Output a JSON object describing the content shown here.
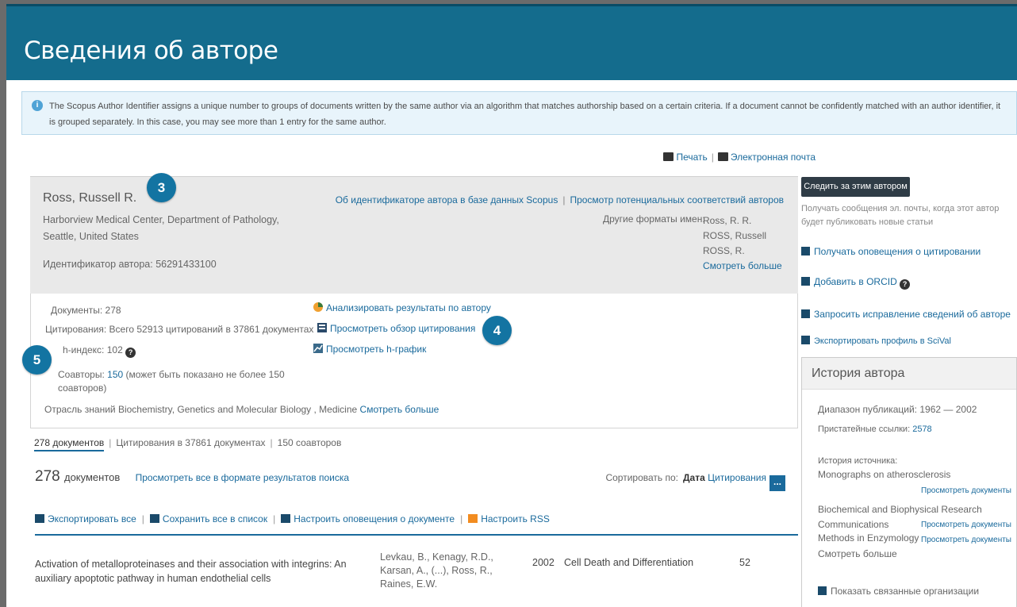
{
  "header": {
    "title": "Сведения об авторе"
  },
  "info": {
    "icon": "info-icon",
    "text": "The Scopus Author Identifier assigns a unique number to groups of documents written by the same author via an algorithm that matches authorship based on a certain criteria. If a document cannot be confidently matched with an author identifier, it is grouped separately. In this case, you may see more than 1 entry for the same author."
  },
  "toolbar": {
    "print": "Печать",
    "email": "Электронная почта"
  },
  "author": {
    "name": "Ross, Russell R.",
    "affiliation": "Harborview Medical Center, Department of Pathology, Seattle, United States",
    "author_id": "Идентификатор автора: 56291433100",
    "link_about_id": "Об идентификаторе автора в базе данных Scopus",
    "link_potential": "Просмотр потенциальных соответствий авторов",
    "other_formats_label": "Другие форматы имен:",
    "other_formats": [
      "Ross, R. R.",
      "ROSS, Russell",
      "ROSS, R."
    ],
    "show_more": "Смотреть больше"
  },
  "badges": {
    "b3": "3",
    "b4": "4",
    "b5": "5"
  },
  "metrics": {
    "documents_label": "Документы:",
    "documents_value": "278",
    "citations_label": "Цитирования:",
    "citations_value": "Всего 52913 цитирований в 37861 документах",
    "hindex_label": "h-индекс:",
    "hindex_value": "102",
    "coauthors_label": "Соавторы:",
    "coauthors_value": "150",
    "coauthors_note": "(может быть показано не более 150 соавторов)",
    "subject_label": "Отрасль знаний",
    "subject_value": "Biochemistry, Genetics and Molecular Biology ,  Medicine",
    "subject_more": "Смотреть больше",
    "link_analyze": "Анализировать результаты по автору",
    "link_citation_overview": "Просмотреть обзор цитирования",
    "link_hgraph": "Просмотреть h-график"
  },
  "tabs": [
    "278 документов",
    "Цитирования в 37861 документах",
    "150 соавторов"
  ],
  "results": {
    "count": "278",
    "count_label": "документов",
    "view_all": "Просмотреть все в формате результатов поиска",
    "sort_label": "Сортировать по:",
    "sort_date": "Дата",
    "sort_citations": "Цитирования",
    "sort_more": "..."
  },
  "actions": [
    "Экспортировать все",
    "Сохранить все в список",
    "Настроить оповещения о документе",
    "Настроить RSS"
  ],
  "documents": [
    {
      "title": "Activation of metalloproteinases and their association with integrins: An auxiliary apoptotic pathway in human endothelial cells",
      "authors": "Levkau, B., Kenagy, R.D., Karsan, A., (...), Ross, R., Raines, E.W.",
      "year": "2002",
      "source": "Cell Death and Differentiation",
      "cited": "52"
    }
  ],
  "sidebar": {
    "follow_button": "Следить за этим автором",
    "follow_desc": "Получать сообщения эл. почты, когда этот автор будет публиковать новые статьи",
    "links": [
      "Получать оповещения о цитировании",
      "Добавить в ORCID",
      "Запросить исправление сведений об авторе",
      "Экспортировать профиль в SciVal"
    ]
  },
  "history": {
    "title": "История автора",
    "pub_range_label": "Диапазон публикаций:",
    "pub_range_value": "1962 — 2002",
    "refs_label": "Пристатейные ссылки:",
    "refs_value": "2578",
    "source_history_label": "История источника:",
    "sources": [
      "Monographs on atherosclerosis",
      "Biochemical and Biophysical Research Communications",
      "Methods in Enzymology"
    ],
    "view_docs": "Просмотреть документы",
    "show_more": "Смотреть больше",
    "related_orgs": "Показать связанные организации"
  }
}
